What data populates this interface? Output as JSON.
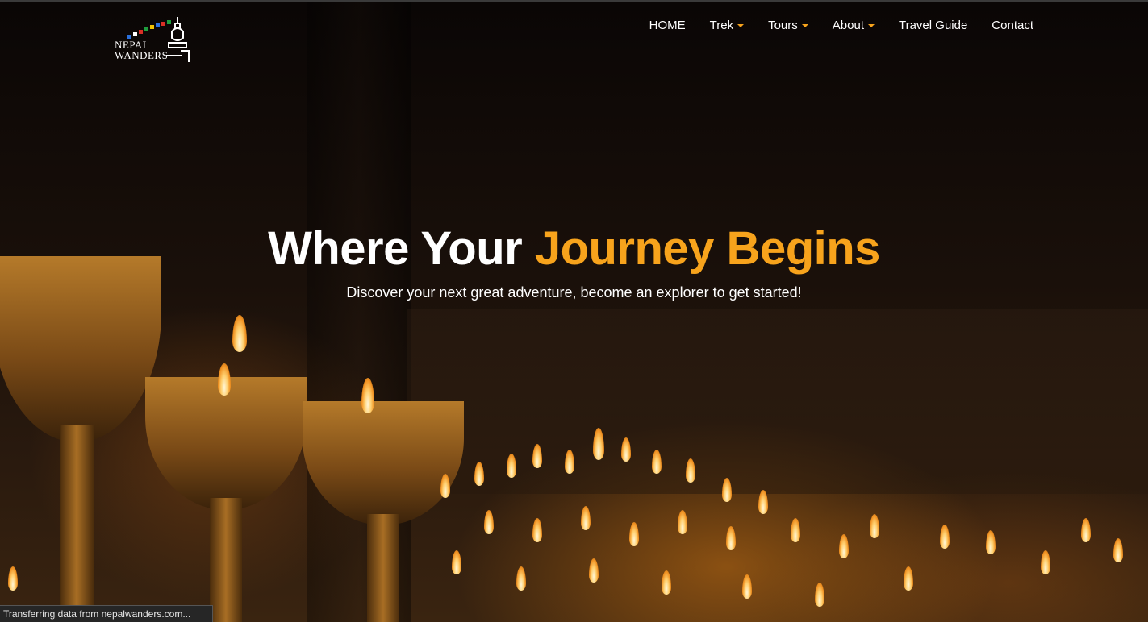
{
  "logo": {
    "line1": "NEPAL",
    "line2": "WANDERS"
  },
  "nav": {
    "items": [
      {
        "label": "HOME",
        "dropdown": false
      },
      {
        "label": "Trek",
        "dropdown": true
      },
      {
        "label": "Tours",
        "dropdown": true
      },
      {
        "label": "About",
        "dropdown": true
      },
      {
        "label": "Travel Guide",
        "dropdown": false
      },
      {
        "label": "Contact",
        "dropdown": false
      }
    ]
  },
  "hero": {
    "title_plain": "Where Your ",
    "title_accent": "Journey Begins",
    "subtitle": "Discover your next great adventure, become an explorer to get started!"
  },
  "statusbar": {
    "text": "Transferring data from nepalwanders.com..."
  },
  "colors": {
    "accent": "#f7a31c",
    "text": "#ffffff",
    "background": "#0d0806"
  }
}
